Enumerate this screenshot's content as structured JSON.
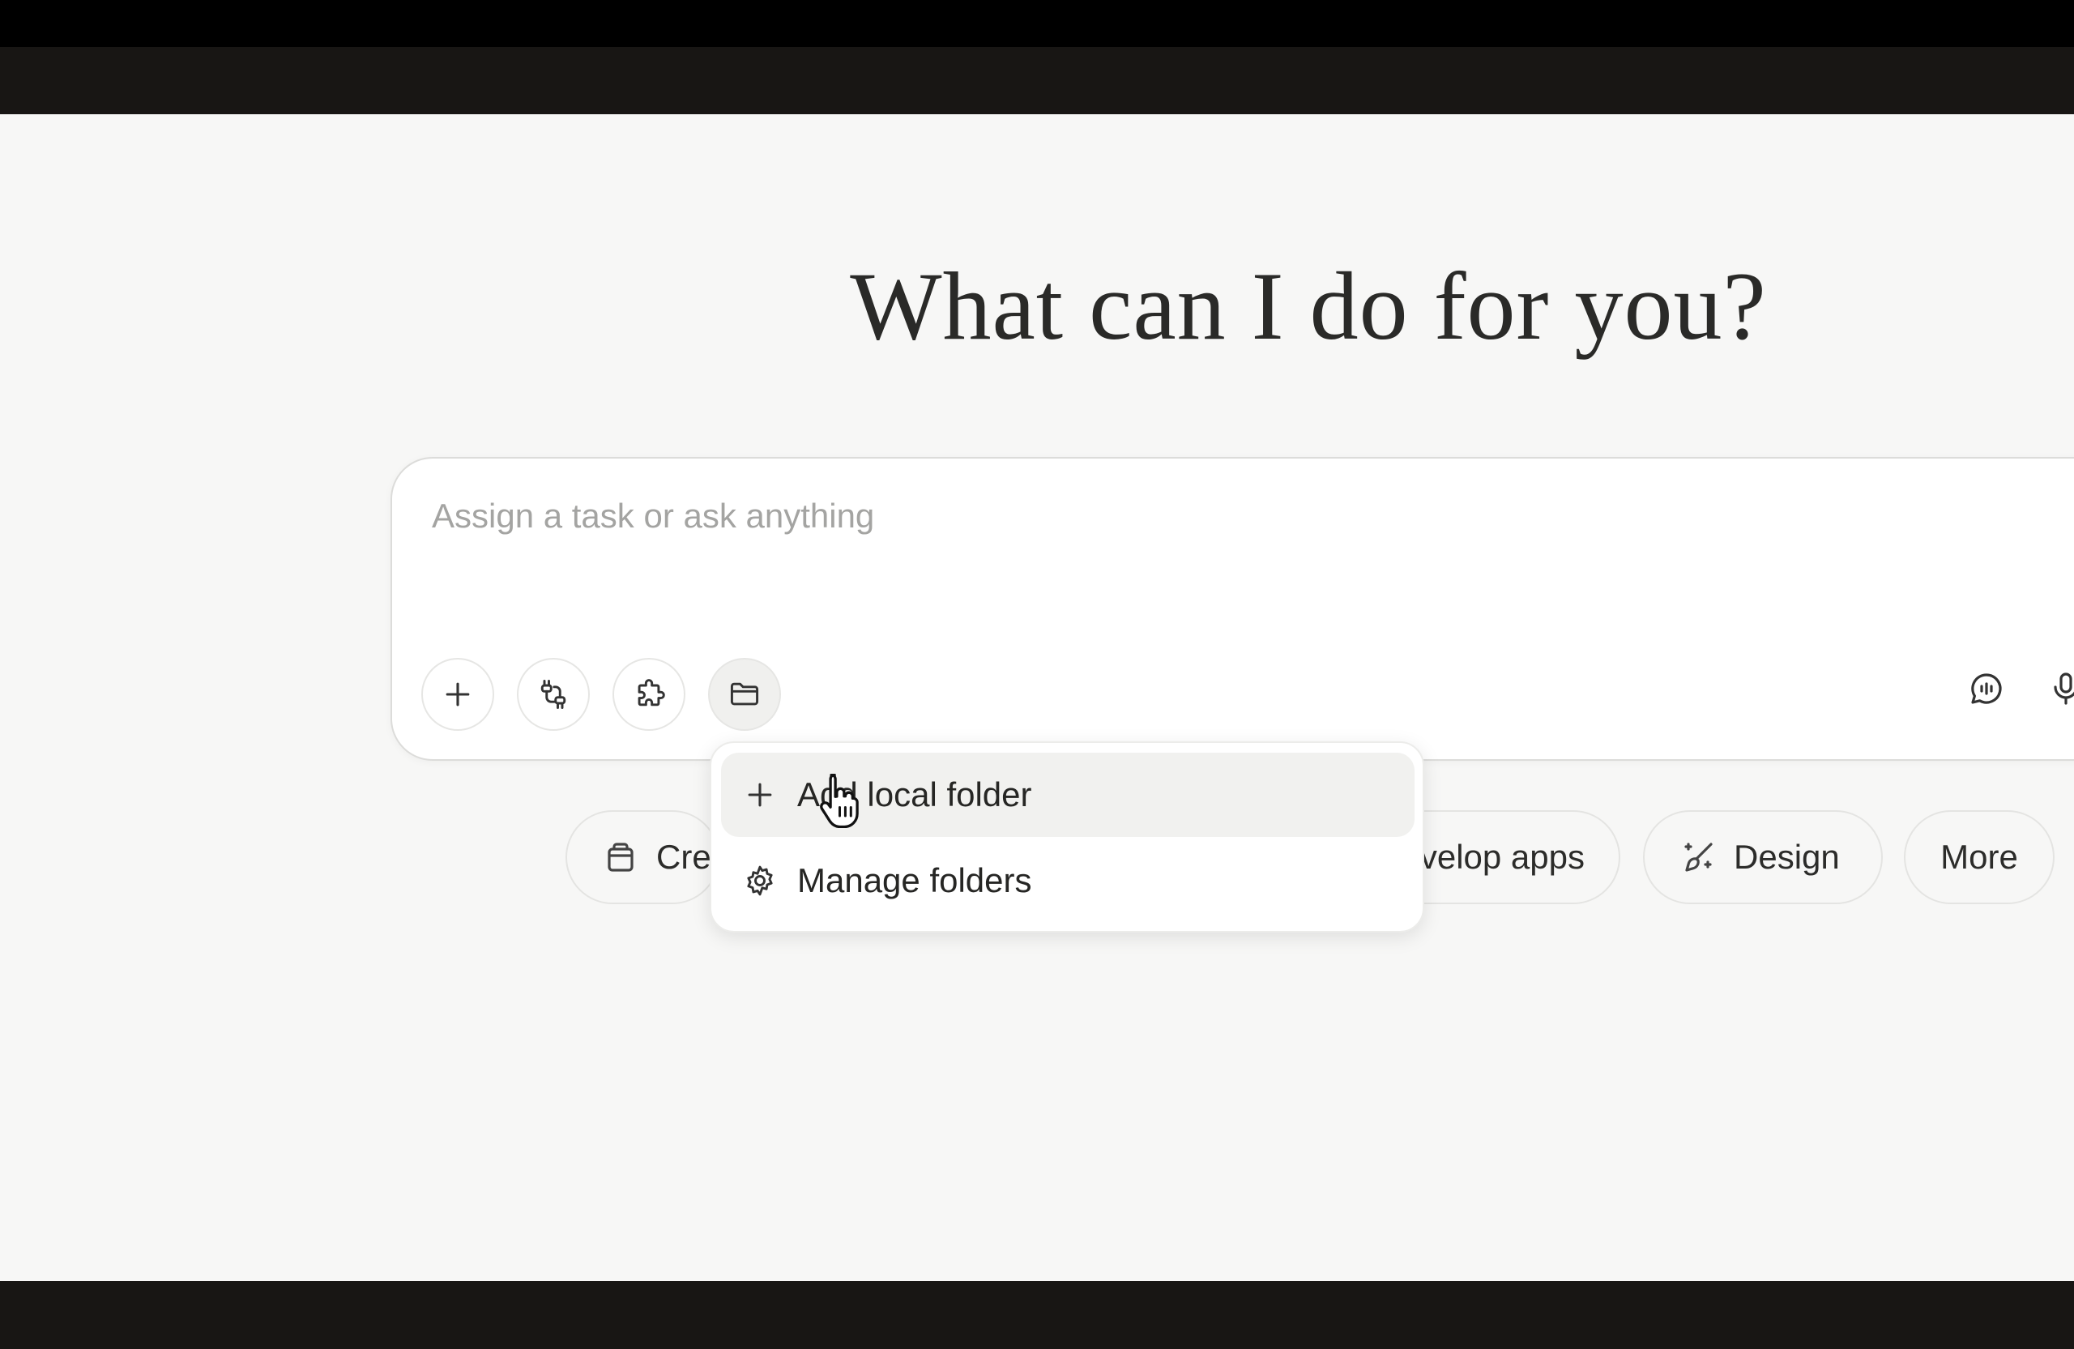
{
  "hero": {
    "title": "What can I do for you?"
  },
  "composer": {
    "placeholder": "Assign a task or ask anything",
    "tools": [
      {
        "icon": "plus-icon"
      },
      {
        "icon": "connector-icon"
      },
      {
        "icon": "puzzle-icon"
      },
      {
        "icon": "folder-icon"
      }
    ],
    "right_icons": [
      {
        "icon": "voice-chat-icon"
      },
      {
        "icon": "microphone-icon"
      }
    ]
  },
  "folder_menu": {
    "items": [
      {
        "label": "Add local folder",
        "icon": "plus-icon"
      },
      {
        "label": "Manage folders",
        "icon": "gear-icon"
      }
    ]
  },
  "quick_actions": {
    "create_label": "Create",
    "develop_label": "Develop apps",
    "design_label": "Design",
    "more_label": "More"
  },
  "colors": {
    "background": "#f7f7f6",
    "frame": "#181614",
    "text": "#2a2a28",
    "placeholder": "#a4a4a2"
  }
}
